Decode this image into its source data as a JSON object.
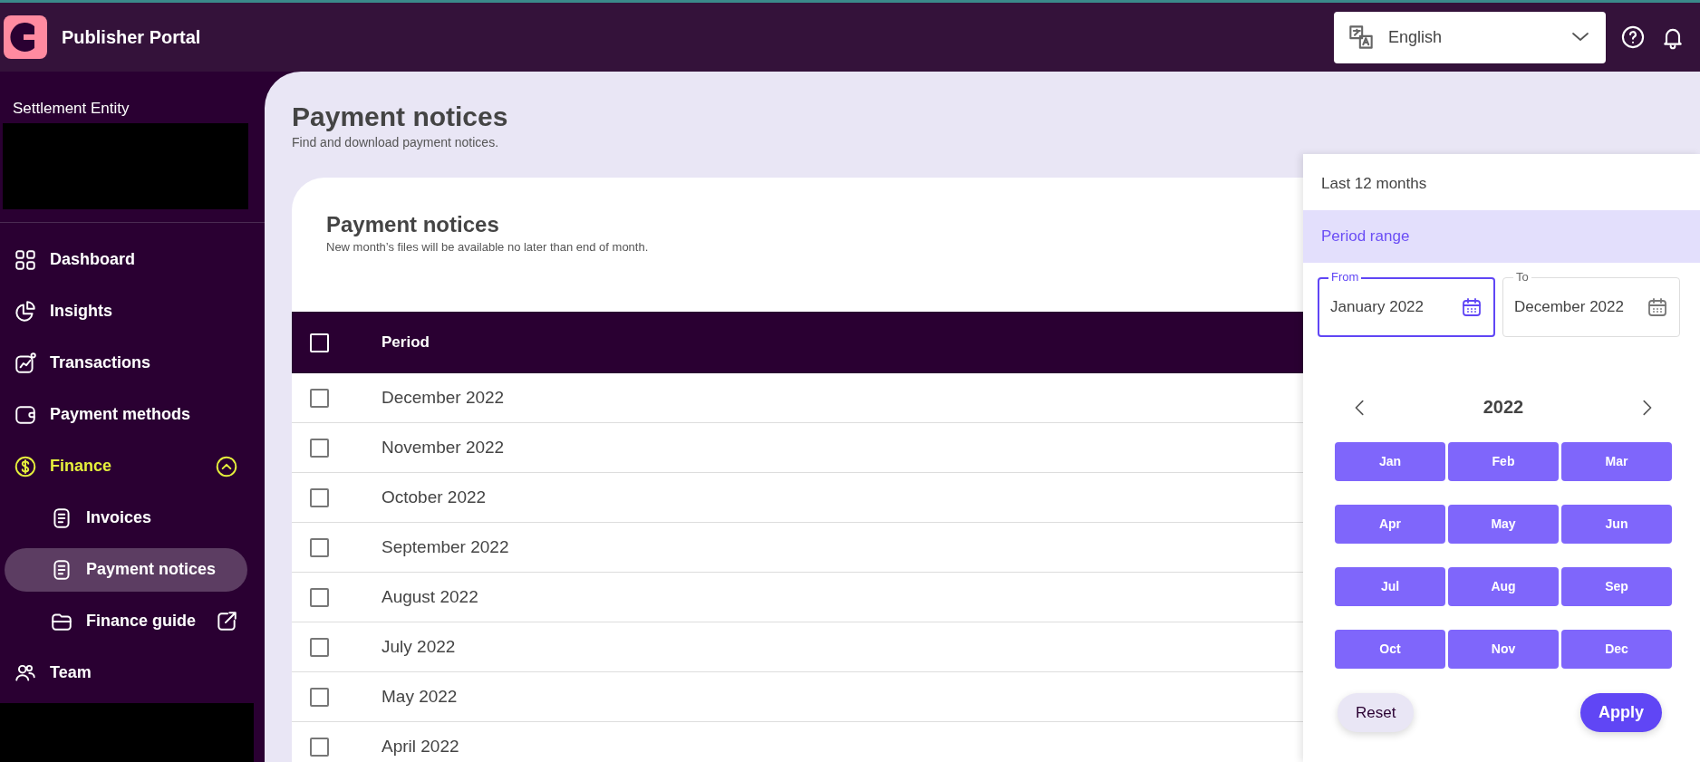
{
  "app": {
    "title": "Publisher Portal"
  },
  "language": {
    "value": "English"
  },
  "sidebar": {
    "entity_label": "Settlement Entity",
    "items": [
      {
        "label": "Dashboard",
        "selected": false
      },
      {
        "label": "Insights",
        "selected": false
      },
      {
        "label": "Transactions",
        "selected": false
      },
      {
        "label": "Payment methods",
        "selected": false
      },
      {
        "label": "Finance",
        "selected": false,
        "expanded": true,
        "children": [
          {
            "label": "Invoices",
            "selected": false,
            "external": false
          },
          {
            "label": "Payment notices",
            "selected": true,
            "external": false
          },
          {
            "label": "Finance guide",
            "selected": false,
            "external": true
          }
        ]
      },
      {
        "label": "Team",
        "selected": false
      }
    ]
  },
  "page": {
    "title": "Payment notices",
    "subtitle": "Find and download payment notices."
  },
  "card": {
    "title": "Payment notices",
    "subtitle": "New month’s files will be available no later than end of month."
  },
  "table": {
    "columns": [
      "Period"
    ],
    "all_checked": false,
    "rows": [
      {
        "period": "December 2022",
        "checked": false
      },
      {
        "period": "November 2022",
        "checked": false
      },
      {
        "period": "October 2022",
        "checked": false
      },
      {
        "period": "September 2022",
        "checked": false
      },
      {
        "period": "August 2022",
        "checked": false
      },
      {
        "period": "July 2022",
        "checked": false
      },
      {
        "period": "May 2022",
        "checked": false
      },
      {
        "period": "April 2022",
        "checked": false
      }
    ]
  },
  "period_picker": {
    "options": [
      {
        "label": "Last 12 months",
        "selected": false
      },
      {
        "label": "Period range",
        "selected": true
      }
    ],
    "from": {
      "label": "From",
      "value": "January 2022",
      "focused": true
    },
    "to": {
      "label": "To",
      "value": "December 2022",
      "focused": false
    },
    "year": "2022",
    "months": [
      "Jan",
      "Feb",
      "Mar",
      "Apr",
      "May",
      "Jun",
      "Jul",
      "Aug",
      "Sep",
      "Oct",
      "Nov",
      "Dec"
    ],
    "reset": "Reset",
    "apply": "Apply"
  }
}
